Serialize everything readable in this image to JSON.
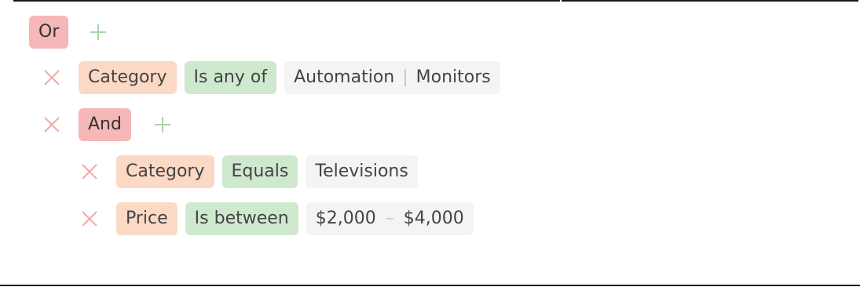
{
  "filter": {
    "root_group_label": "Or",
    "rules": [
      {
        "field": "Category",
        "operator": "Is any of",
        "values": [
          "Automation",
          "Monitors"
        ]
      }
    ],
    "nested_group": {
      "label": "And",
      "rules": [
        {
          "field": "Category",
          "operator": "Equals",
          "value": "Televisions"
        },
        {
          "field": "Price",
          "operator": "Is between",
          "from": "$2,000",
          "to": "$4,000"
        }
      ]
    }
  },
  "icons": {
    "add": "plus-icon",
    "remove": "close-icon"
  },
  "colors": {
    "group_chip": "#f5b7b7",
    "field_chip": "#fbd9c5",
    "operator_chip": "#cfe9cf",
    "value_chip": "#f4f4f4",
    "remove_icon": "#f2aaaa",
    "add_icon": "#a6d7a6"
  }
}
